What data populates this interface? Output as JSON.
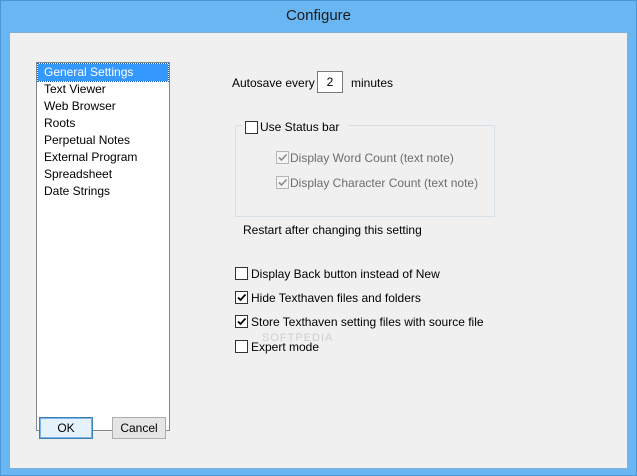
{
  "window": {
    "title": "Configure"
  },
  "categories": {
    "items": [
      {
        "label": "General Settings"
      },
      {
        "label": "Text Viewer"
      },
      {
        "label": "Web Browser"
      },
      {
        "label": "Roots"
      },
      {
        "label": "Perpetual Notes"
      },
      {
        "label": "External Program"
      },
      {
        "label": "Spreadsheet"
      },
      {
        "label": "Date Strings"
      }
    ],
    "selected_index": 0
  },
  "autosave": {
    "prefix": "Autosave every",
    "value": "2",
    "suffix": "minutes"
  },
  "status_bar": {
    "label": "Use Status bar",
    "checked": false,
    "word_count": {
      "label": "Display Word Count (text note)",
      "checked": true,
      "enabled": false
    },
    "char_count": {
      "label": "Display Character Count (text note)",
      "checked": true,
      "enabled": false
    }
  },
  "restart_note": "Restart after changing this setting",
  "options": [
    {
      "label": "Display Back button instead of New",
      "checked": false
    },
    {
      "label": "Hide Texthaven files and folders",
      "checked": true
    },
    {
      "label": "Store Texthaven setting files with source file",
      "checked": true
    },
    {
      "label": "Expert mode",
      "checked": false
    }
  ],
  "watermark": "SOFTPEDIA",
  "buttons": {
    "ok": "OK",
    "cancel": "Cancel"
  }
}
